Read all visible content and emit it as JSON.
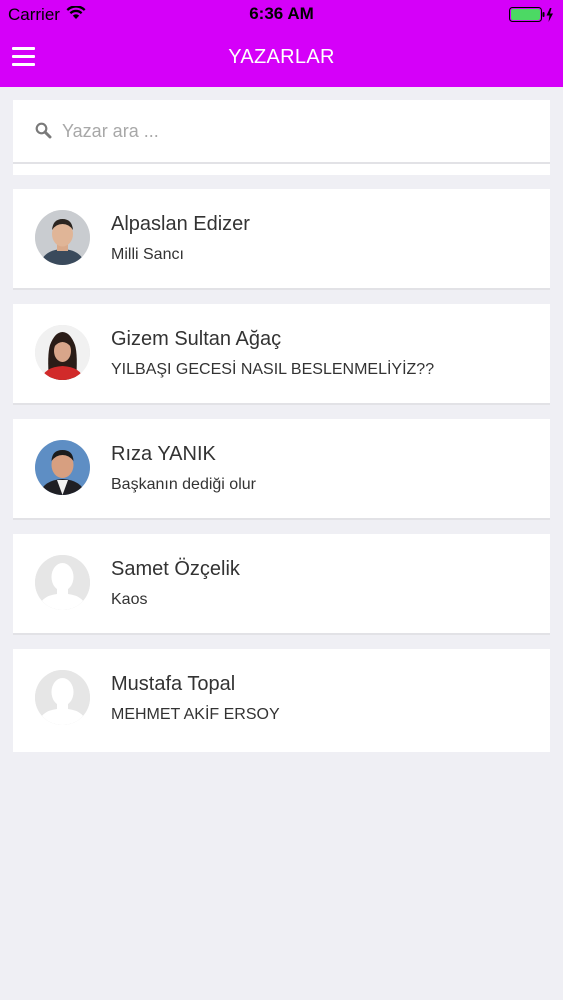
{
  "status_bar": {
    "carrier": "Carrier",
    "time": "6:36 AM"
  },
  "header": {
    "title": "YAZARLAR",
    "menu_icon": "hamburger-menu-icon"
  },
  "search": {
    "placeholder": "Yazar ara ...",
    "value": "",
    "icon": "search-icon"
  },
  "authors": [
    {
      "name": "Alpaslan Edizer",
      "article": "Milli Sancı",
      "avatar": "photo"
    },
    {
      "name": "Gizem Sultan Ağaç",
      "article": "YILBAŞI GECESİ NASIL BESLENMELİYİZ??",
      "avatar": "photo"
    },
    {
      "name": "Rıza YANIK",
      "article": "Başkanın dediği olur",
      "avatar": "photo"
    },
    {
      "name": "Samet Özçelik",
      "article": "Kaos",
      "avatar": "placeholder"
    },
    {
      "name": "Mustafa Topal",
      "article": "MEHMET AKİF ERSOY",
      "avatar": "placeholder"
    }
  ],
  "colors": {
    "accent": "#d500f9",
    "background": "#efeff4",
    "battery": "#4cd964"
  }
}
